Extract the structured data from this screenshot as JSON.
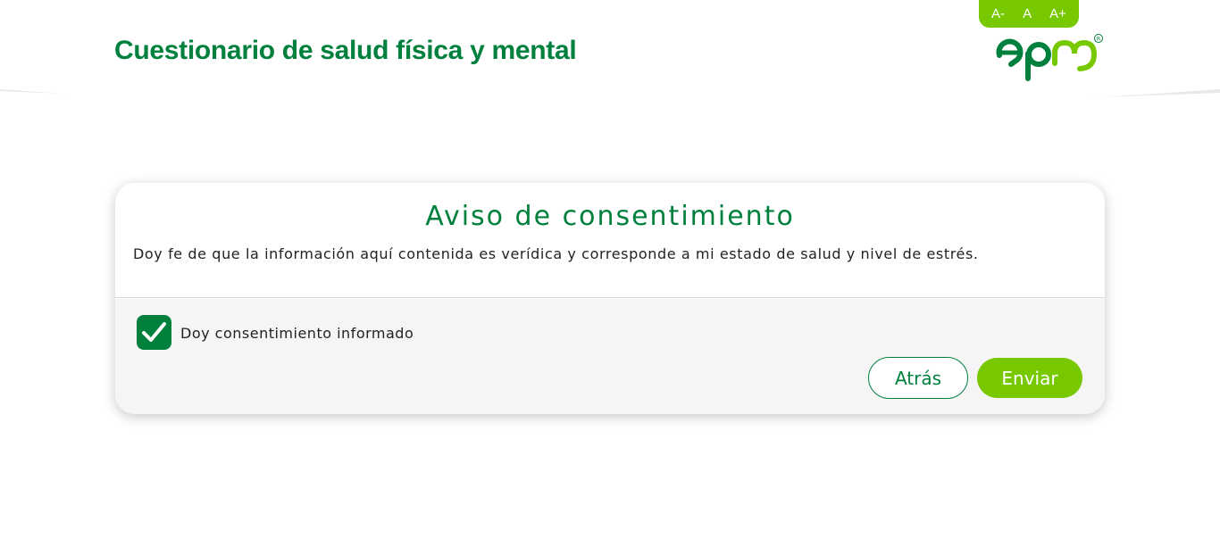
{
  "header": {
    "title": "Cuestionario de salud física y mental",
    "font_controls": [
      "A-",
      "A",
      "A+"
    ],
    "logo_text": "epm",
    "logo_mark": "®"
  },
  "consent": {
    "title": "Aviso de consentimiento",
    "text": "Doy fe de que la información aquí contenida es verídica y corresponde a mi estado de salud y nivel de estrés.",
    "checkbox_label": "Doy consentimiento informado",
    "checkbox_checked": true,
    "back_label": "Atrás",
    "send_label": "Enviar"
  },
  "colors": {
    "brand_green": "#00803d",
    "accent_lime": "#78c800",
    "panel_gray": "#f5f5f5"
  }
}
